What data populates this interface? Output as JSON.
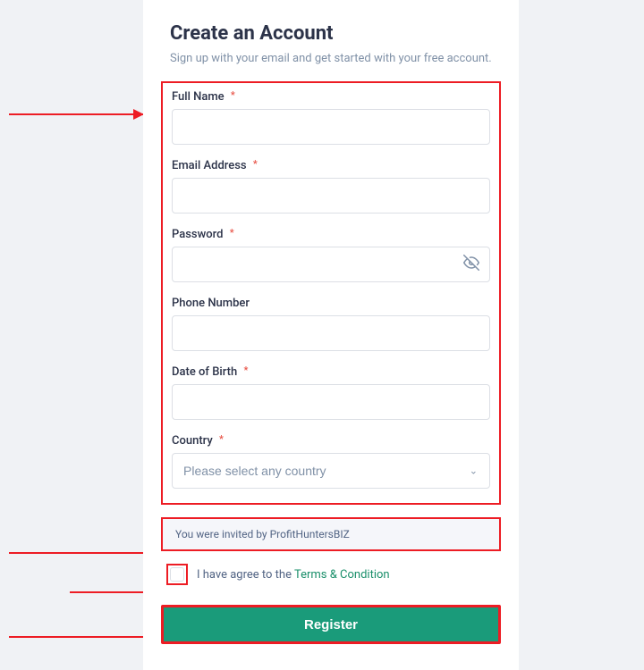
{
  "header": {
    "title": "Create an Account",
    "subtitle": "Sign up with your email and get started with your free account."
  },
  "fields": {
    "full_name": {
      "label": "Full Name",
      "required": "*"
    },
    "email": {
      "label": "Email Address",
      "required": "*"
    },
    "password": {
      "label": "Password",
      "required": "*"
    },
    "phone": {
      "label": "Phone Number"
    },
    "dob": {
      "label": "Date of Birth",
      "required": "*"
    },
    "country": {
      "label": "Country",
      "required": "*",
      "placeholder": "Please select any country"
    }
  },
  "invite": {
    "text": "You were invited by ProfitHuntersBIZ"
  },
  "terms": {
    "prefix": "I have agree to the ",
    "link": "Terms & Condition"
  },
  "button": {
    "register": "Register"
  }
}
